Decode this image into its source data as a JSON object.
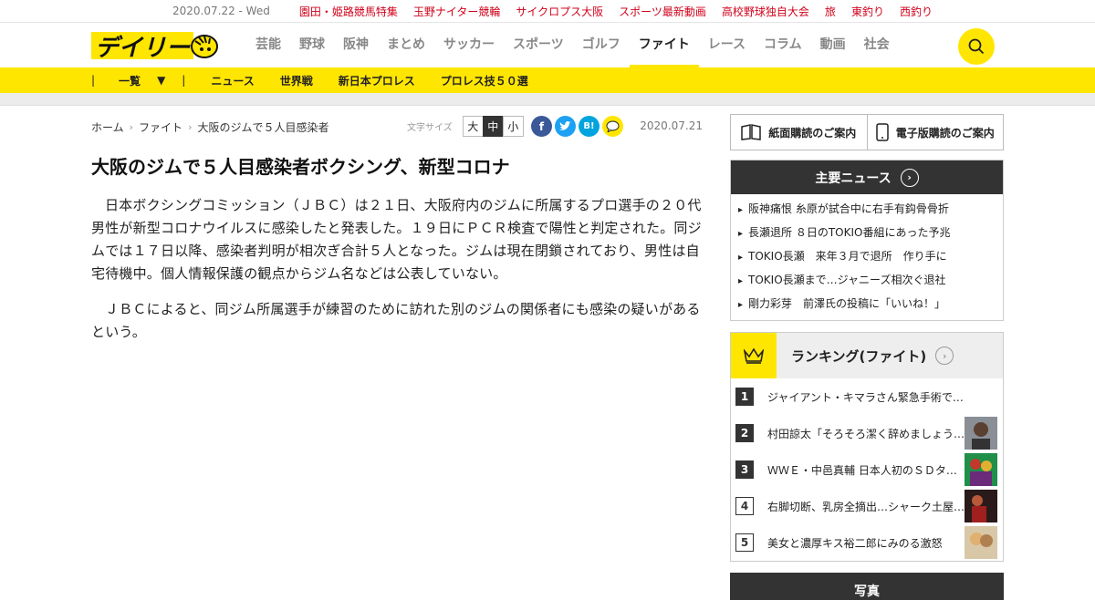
{
  "topbar": {
    "date": "2020.07.22 - Wed",
    "links": [
      "園田・姫路競馬特集",
      "玉野ナイター競輪",
      "サイクロプス大阪",
      "スポーツ最新動画",
      "高校野球独自大会",
      "旅",
      "東釣り",
      "西釣り"
    ]
  },
  "header": {
    "logo_text": "デイリー",
    "nav": [
      "芸能",
      "野球",
      "阪神",
      "まとめ",
      "サッカー",
      "スポーツ",
      "ゴルフ",
      "ファイト",
      "レース",
      "コラム",
      "動画",
      "社会"
    ],
    "active_nav": "ファイト",
    "search_icon": "search-icon"
  },
  "subnav": {
    "all_label": "一覧",
    "links": [
      "ニュース",
      "世界戦",
      "新日本プロレス",
      "プロレス技５０選"
    ]
  },
  "article": {
    "breadcrumb": [
      "ホーム",
      "ファイト",
      "大阪のジムで５人目感染者"
    ],
    "fontsize_label": "文字サイズ",
    "fontsize_options": [
      "大",
      "中",
      "小"
    ],
    "fontsize_selected": "中",
    "pubdate": "2020.07.21",
    "headline": "大阪のジムで５人目感染者ボクシング、新型コロナ",
    "paragraphs": [
      "日本ボクシングコミッション（ＪＢＣ）は２１日、大阪府内のジムに所属するプロ選手の２０代男性が新型コロナウイルスに感染したと発表した。１９日にＰＣＲ検査で陽性と判定された。同ジムでは１７日以降、感染者判明が相次ぎ合計５人となった。ジムは現在閉鎖されており、男性は自宅待機中。個人情報保護の観点からジム名などは公表していない。",
      "ＪＢＣによると、同ジム所属選手が練習のために訪れた別のジムの関係者にも感染の疑いがあるという。"
    ]
  },
  "sidebar": {
    "paper_sub": "紙面購読のご案内",
    "digital_sub": "電子版購読のご案内",
    "news_title": "主要ニュース",
    "news": [
      "阪神痛恨 糸原が試合中に右手有鈎骨骨折",
      "長瀬退所 ８日のTOKIO番組にあった予兆",
      "TOKIO長瀬　来年３月で退所　作り手に",
      "TOKIO長瀬まで…ジャニーズ相次ぐ退社",
      "剛力彩芽　前澤氏の投稿に「いいね！」"
    ],
    "ranking_title": "ランキング(ファイト)",
    "ranking": [
      {
        "rank": "1",
        "title": "ジャイアント・キマラさん緊急手術で生命…"
      },
      {
        "rank": "2",
        "title": "村田諒太「そろそろ潔く辞めましょう…"
      },
      {
        "rank": "3",
        "title": "ＷＷＥ・中邑真輔 日本人初のＳＤタ…"
      },
      {
        "rank": "4",
        "title": "右脚切断、乳房全摘出…シャーク土屋…"
      },
      {
        "rank": "5",
        "title": "美女と濃厚キス裕二郎にみのる激怒"
      }
    ],
    "photo_title": "写真"
  },
  "colors": {
    "brand_yellow": "#ffe600",
    "link_red": "#d0021b",
    "dark": "#333333"
  }
}
